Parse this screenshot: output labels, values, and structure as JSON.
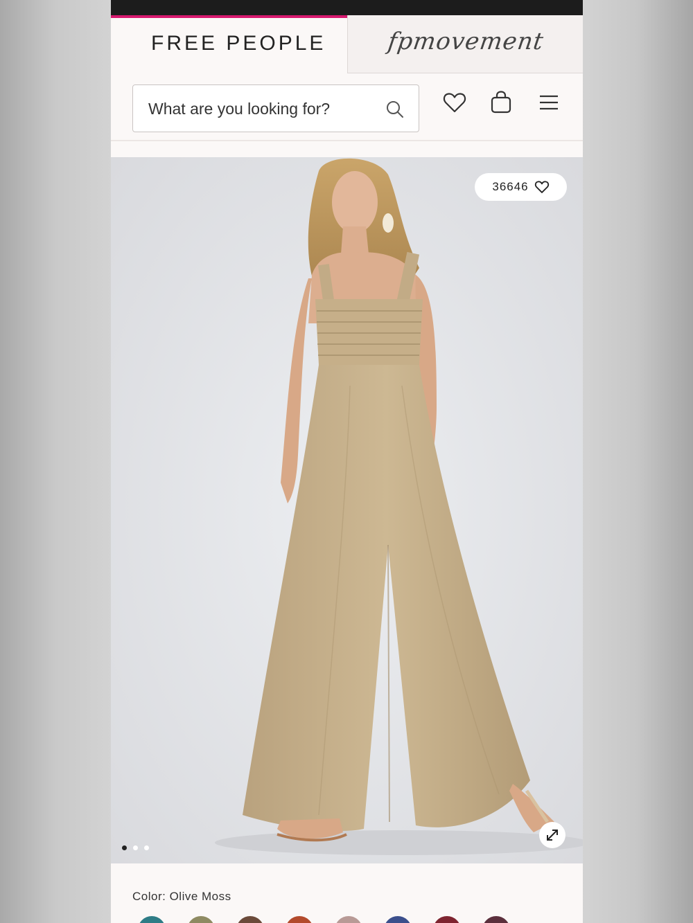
{
  "header": {
    "tab_primary": "FREE PEOPLE",
    "tab_secondary": "fpmovement",
    "accent_color": "#d6196e"
  },
  "search": {
    "placeholder": "What are you looking for?",
    "icon": "search-icon"
  },
  "header_icons": [
    "heart-icon",
    "shopping-bag-icon",
    "hamburger-menu-icon"
  ],
  "product": {
    "like_count": "36646",
    "image_count": 3,
    "active_image_index": 0,
    "image_description_icon": "product-photo"
  },
  "color": {
    "label": "Color: Olive Moss",
    "swatches": [
      "#2e7c86",
      "#8e8a62",
      "#6b4a3a",
      "#b34a2c",
      "#b89a96",
      "#3b4f8c",
      "#7e2430",
      "#5b2f3c"
    ]
  }
}
